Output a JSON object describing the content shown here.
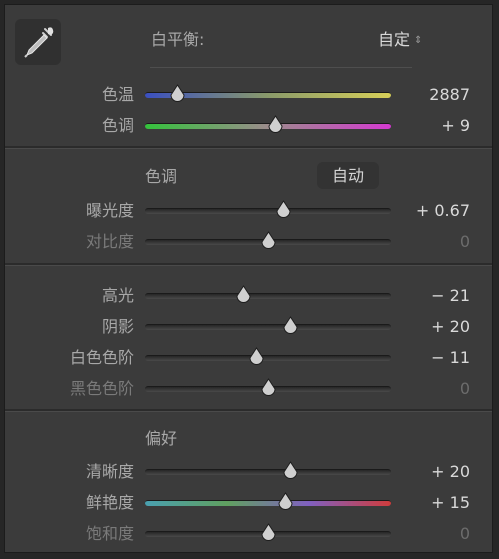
{
  "white_balance": {
    "label": "白平衡:",
    "value": "自定"
  },
  "sections": [
    {
      "rows": [
        {
          "label": "色温",
          "value": "2887",
          "level_pct": 13,
          "track": "temp",
          "dim": false
        },
        {
          "label": "色调",
          "value": "+ 9",
          "level_pct": 53,
          "track": "tint",
          "dim": false
        }
      ]
    },
    {
      "header": "色调",
      "auto_label": "自动",
      "rows": [
        {
          "label": "曝光度",
          "value": "+ 0.67",
          "level_pct": 56,
          "track": "gray",
          "dim": false
        },
        {
          "label": "对比度",
          "value": "0",
          "level_pct": 50,
          "track": "gray",
          "dim": true
        }
      ]
    },
    {
      "rows": [
        {
          "label": "高光",
          "value": "− 21",
          "level_pct": 40,
          "track": "gray",
          "dim": false
        },
        {
          "label": "阴影",
          "value": "+ 20",
          "level_pct": 59,
          "track": "gray",
          "dim": false
        },
        {
          "label": "白色色阶",
          "value": "− 11",
          "level_pct": 45,
          "track": "gray",
          "dim": false
        },
        {
          "label": "黑色色阶",
          "value": "0",
          "level_pct": 50,
          "track": "gray",
          "dim": true
        }
      ]
    },
    {
      "header": "偏好",
      "rows": [
        {
          "label": "清晰度",
          "value": "+ 20",
          "level_pct": 59,
          "track": "gray",
          "dim": false
        },
        {
          "label": "鲜艳度",
          "value": "+ 15",
          "level_pct": 57,
          "track": "vib",
          "dim": false
        },
        {
          "label": "饱和度",
          "value": "0",
          "level_pct": 50,
          "track": "gray",
          "dim": true
        }
      ]
    }
  ],
  "icons": {
    "picker": "eyedropper-icon",
    "dropdown": "updown-caret-icon"
  }
}
